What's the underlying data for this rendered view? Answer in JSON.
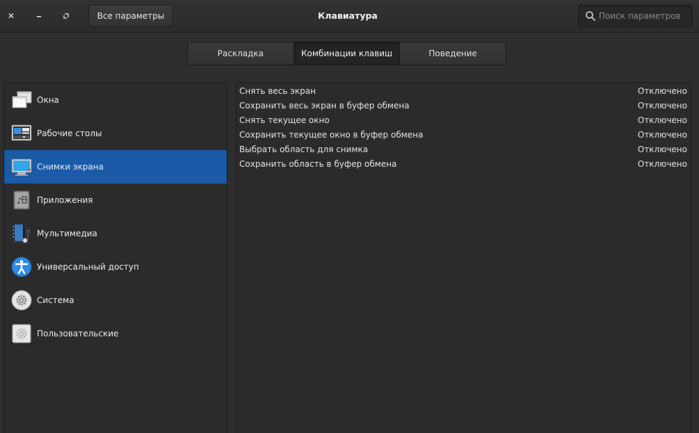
{
  "window": {
    "title": "Клавиатура",
    "back_button": "Все параметры",
    "search_placeholder": "Поиск параметров"
  },
  "tabs": [
    {
      "label": "Раскладка",
      "active": false
    },
    {
      "label": "Комбинации клавиш",
      "active": true
    },
    {
      "label": "Поведение",
      "active": false
    }
  ],
  "sidebar": {
    "selected_index": 2,
    "items": [
      {
        "label": "Окна",
        "icon": "windows-icon"
      },
      {
        "label": "Рабочие столы",
        "icon": "workspaces-icon"
      },
      {
        "label": "Снимки экрана",
        "icon": "screenshot-icon"
      },
      {
        "label": "Приложения",
        "icon": "applications-icon"
      },
      {
        "label": "Мультимедиа",
        "icon": "multimedia-icon"
      },
      {
        "label": "Универсальный доступ",
        "icon": "accessibility-icon"
      },
      {
        "label": "Система",
        "icon": "system-gear-icon"
      },
      {
        "label": "Пользовательские",
        "icon": "custom-gear-icon"
      }
    ]
  },
  "shortcuts": [
    {
      "action": "Снять весь экран",
      "accel": "Отключено"
    },
    {
      "action": "Сохранить весь экран в буфер обмена",
      "accel": "Отключено"
    },
    {
      "action": "Снять текущее окно",
      "accel": "Отключено"
    },
    {
      "action": "Сохранить текущее окно в буфер обмена",
      "accel": "Отключено"
    },
    {
      "action": "Выбрать область для снимка",
      "accel": "Отключено"
    },
    {
      "action": "Сохранить область в буфер обмена",
      "accel": "Отключено"
    }
  ],
  "colors": {
    "accent": "#1a5aa6",
    "background": "#2e2e2e"
  }
}
